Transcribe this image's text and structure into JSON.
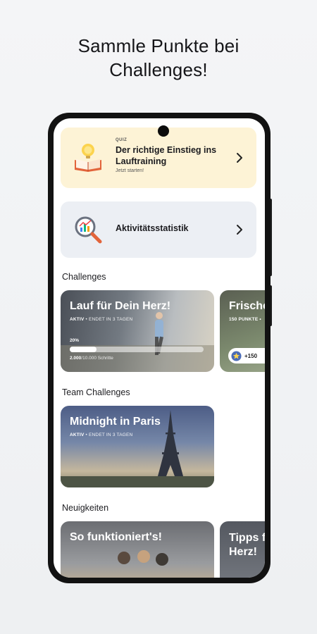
{
  "headline": {
    "line1": "Sammle Punkte bei",
    "line2": "Challenges!"
  },
  "quiz": {
    "label": "QUIZ",
    "title": "Der richtige Einstieg ins Lauftraining",
    "cta": "Jetzt starten!",
    "icon": "lightbulb-book-icon"
  },
  "stats": {
    "title": "Aktivitätsstatistik",
    "icon": "magnifier-chart-icon"
  },
  "sections": {
    "challenges": "Challenges",
    "team_challenges": "Team Challenges",
    "news": "Neuigkeiten"
  },
  "challenges": [
    {
      "title": "Lauf für Dein Herz!",
      "status": "AKTIV",
      "ends": "• ENDET IN 3 TAGEN",
      "progress_label": "20%",
      "progress": 0.2,
      "steps_done": "2.000",
      "steps_total": "/10.000 Schritte"
    },
    {
      "title": "Frische",
      "points": "150 PUNKTE •",
      "chip": "+150"
    }
  ],
  "team_challenges": [
    {
      "title": "Midnight in Paris",
      "status": "AKTIV",
      "ends": "• ENDET IN 3 TAGEN"
    }
  ],
  "news": [
    {
      "title": "So funktioniert's!"
    },
    {
      "title_line1": "Tipps f",
      "title_line2": "Herz!"
    }
  ],
  "colors": {
    "quiz_bg": "#fdf3d6",
    "stats_bg": "#eceff4",
    "phone_frame": "#121212"
  }
}
